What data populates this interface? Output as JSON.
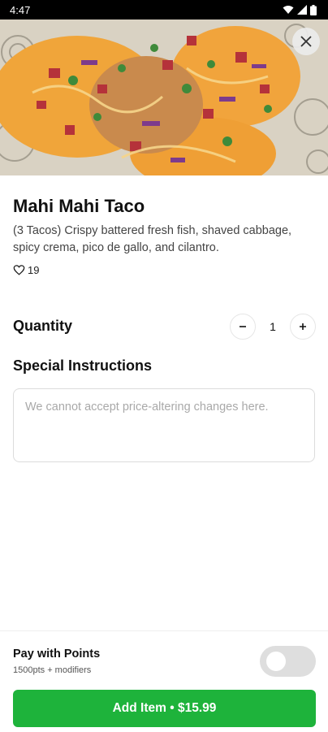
{
  "status_bar": {
    "time": "4:47"
  },
  "item": {
    "name": "Mahi Mahi Taco",
    "description": "(3 Tacos) Crispy battered fresh fish, shaved cabbage, spicy crema, pico de gallo, and cilantro.",
    "likes": "19"
  },
  "quantity": {
    "label": "Quantity",
    "value": "1"
  },
  "special_instructions": {
    "label": "Special Instructions",
    "placeholder": "We cannot accept price-altering changes here."
  },
  "footer": {
    "pay_title": "Pay with Points",
    "pay_subtitle": "1500pts + modifiers",
    "pay_with_points_enabled": false,
    "add_button": "Add Item • $15.99"
  },
  "colors": {
    "accent_green": "#1eb33b",
    "toggle_off": "#dedede"
  },
  "icons": [
    "wifi-icon",
    "signal-icon",
    "battery-icon",
    "close-icon",
    "heart-icon",
    "minus-icon",
    "plus-icon"
  ]
}
